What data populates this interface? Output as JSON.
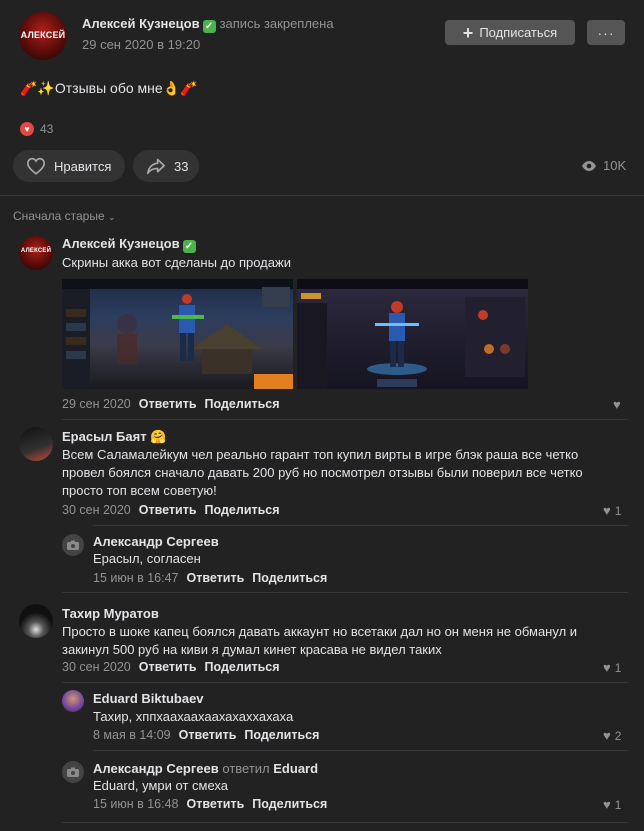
{
  "post": {
    "author": "Алексей Кузнецов",
    "avatar_text": "АЛЕКСЕЙ",
    "pinned_label": "запись закреплена",
    "date": "29 сен 2020 в 19:20",
    "subscribe_label": "Подписаться",
    "more_label": "···",
    "text": "🧨✨Отзывы обо мне👌🧨",
    "reactions_count": "43",
    "like_label": "Нравится",
    "share_count": "33",
    "views": "10K"
  },
  "comments_sort": "Сначала старые",
  "comments": [
    {
      "name": "Алексей Кузнецов",
      "text": "Скрины акка вот сделаны до продажи",
      "date": "29 сен 2020",
      "reply": "Ответить",
      "share": "Поделиться"
    },
    {
      "name": "Ерасыл Баят 🤗",
      "text": "Всем Саламалейкум чел реально гарант топ купил вирты в игре блэк раша все четко провел боялся сначало давать 200 руб но посмотрел отзывы были поверил все четко просто топ всем советую!",
      "date": "30 сен 2020",
      "reply": "Ответить",
      "share": "Поделиться",
      "likes": "1"
    },
    {
      "name": "Александр Сергеев",
      "text": "Ерасыл, согласен",
      "date": "15 июн в 16:47",
      "reply": "Ответить",
      "share": "Поделиться"
    },
    {
      "name": "Тахир Муратов",
      "text": "Просто в шоке капец боялся давать аккаунт но всетаки дал но он меня не обманул и закинул 500 руб на киви я думал кинет красава не видел таких",
      "date": "30 сен 2020",
      "reply": "Ответить",
      "share": "Поделиться",
      "likes": "1"
    },
    {
      "name": "Eduard Biktubaev",
      "text": "Тахир, хппхаахаахаахахаххахаха",
      "date": "8 мая в 14:09",
      "reply": "Ответить",
      "share": "Поделиться",
      "likes": "2"
    },
    {
      "name": "Александр Сергеев",
      "replied_word": "ответил",
      "replied_to": "Eduard",
      "text": "Eduard, умри от смеха",
      "date": "15 июн в 16:48",
      "reply": "Ответить",
      "share": "Поделиться",
      "likes": "1"
    }
  ],
  "colors": {
    "background": "#222222",
    "button": "#555555",
    "pill": "#333333",
    "muted": "#939393",
    "text": "#e1e3e6",
    "like_red": "#e64646",
    "verified": "#4bb34b"
  }
}
